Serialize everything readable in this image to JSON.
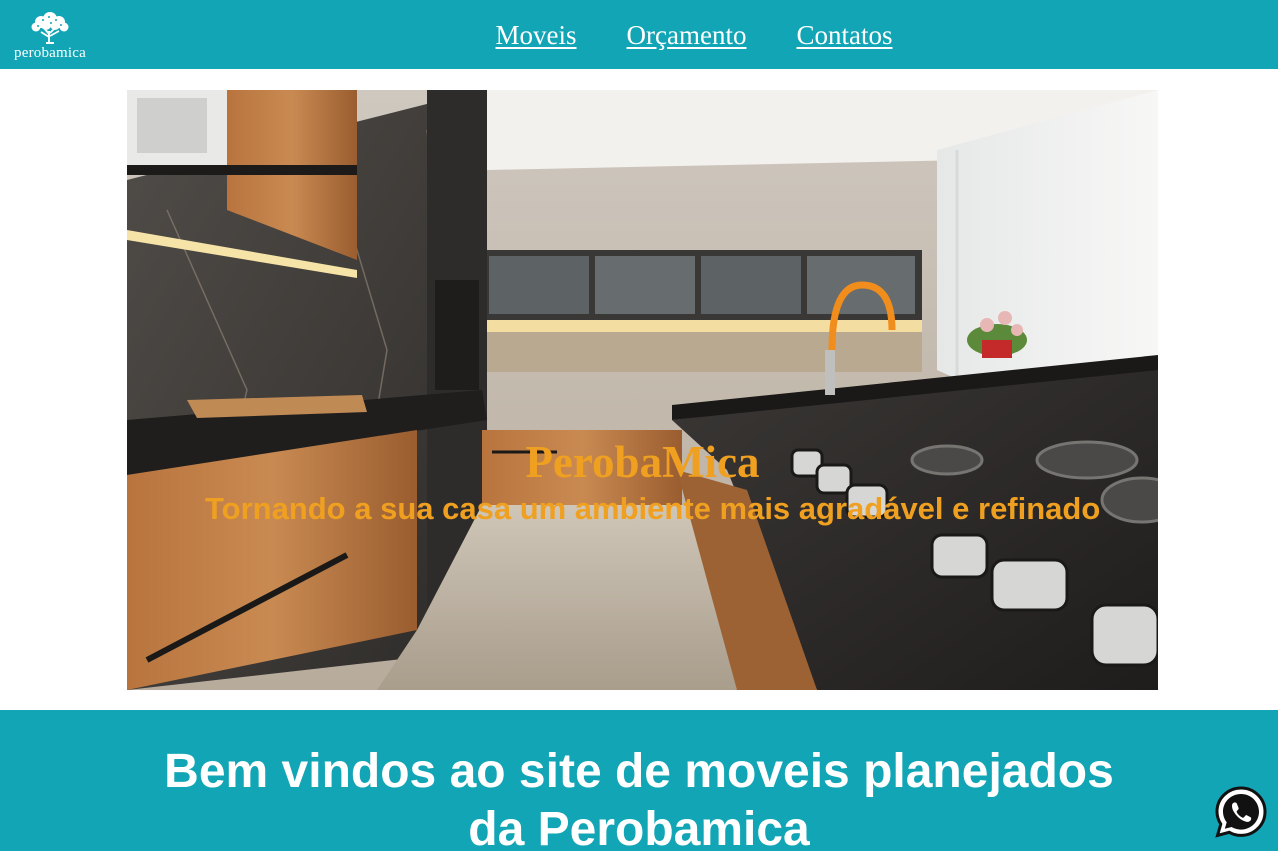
{
  "header": {
    "logo_text": "perobamica",
    "nav": [
      {
        "label": "Moveis"
      },
      {
        "label": "Orçamento"
      },
      {
        "label": "Contatos"
      }
    ]
  },
  "hero": {
    "title": "PerobaMica",
    "subtitle": "Tornando a sua casa um ambiente mais agradável e refinado"
  },
  "welcome": {
    "heading": "Bem vindos ao site de moveis planejados da Perobamica"
  },
  "floating": {
    "whatsapp_icon": "whatsapp-icon"
  },
  "colors": {
    "header_bg": "#12a5b5",
    "accent_text": "#f0a020"
  }
}
